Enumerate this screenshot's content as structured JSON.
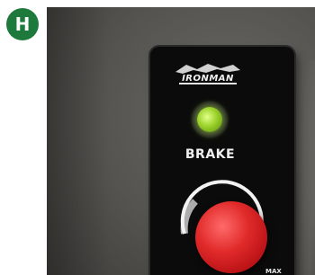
{
  "badge": {
    "letter": "H",
    "color": "#1e7a3c"
  },
  "panel": {
    "brand": "IRONMAN",
    "indicator": {
      "state": "on",
      "color": "#9bd22a"
    },
    "label": "BRAKE",
    "dial_max_label": "MAX",
    "knob_color": "#e12a2a"
  }
}
